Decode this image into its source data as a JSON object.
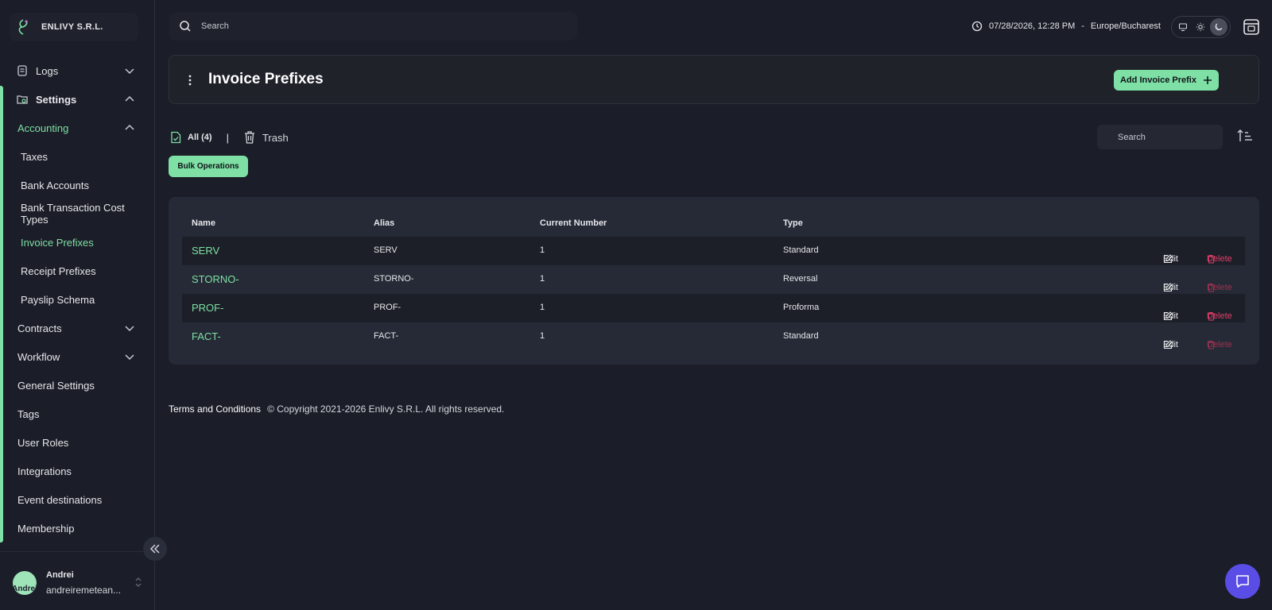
{
  "org": {
    "name": "ENLIVY S.R.L."
  },
  "sidebar": {
    "items": [
      {
        "label": "Logs"
      },
      {
        "label": "Settings"
      },
      {
        "label": "Accounting"
      },
      {
        "label": "Taxes"
      },
      {
        "label": "Bank Accounts"
      },
      {
        "label": "Bank Transaction Cost Types"
      },
      {
        "label": "Invoice Prefixes"
      },
      {
        "label": "Receipt Prefixes"
      },
      {
        "label": "Payslip Schema"
      },
      {
        "label": "Contracts"
      },
      {
        "label": "Workflow"
      },
      {
        "label": "General Settings"
      },
      {
        "label": "Tags"
      },
      {
        "label": "User Roles"
      },
      {
        "label": "Integrations"
      },
      {
        "label": "Event destinations"
      },
      {
        "label": "Membership"
      }
    ],
    "user": {
      "name": "Andrei",
      "email": "andreiremetean...",
      "avatar_text": "Andrei"
    }
  },
  "topbar": {
    "search_placeholder": "Search",
    "datetime": "07/28/2026, 12:28 PM",
    "dash": "-",
    "timezone": "Europe/Bucharest"
  },
  "header": {
    "title": "Invoice Prefixes",
    "add_label": "Add Invoice Prefix"
  },
  "filters": {
    "all_label": "All (4)",
    "separator": "|",
    "trash_label": "Trash",
    "search_placeholder": "Search",
    "bulk_label": "Bulk Operations"
  },
  "table": {
    "columns": [
      "Name",
      "Alias",
      "Current Number",
      "Type"
    ],
    "edit_label": "Edit",
    "delete_label": "Delete",
    "rows": [
      {
        "name": "SERV",
        "alias": "SERV",
        "current_number": "1",
        "type": "Standard"
      },
      {
        "name": "STORNO-",
        "alias": "STORNO-",
        "current_number": "1",
        "type": "Reversal"
      },
      {
        "name": "PROF-",
        "alias": "PROF-",
        "current_number": "1",
        "type": "Proforma"
      },
      {
        "name": "FACT-",
        "alias": "FACT-",
        "current_number": "1",
        "type": "Standard"
      }
    ]
  },
  "footer": {
    "terms": "Terms and Conditions",
    "copyright": "© Copyright 2021-2026 Enlivy S.R.L. All rights reserved."
  },
  "colors": {
    "accent": "#7ee0a4",
    "danger": "#e23d6a",
    "chat": "#5a4de6",
    "background": "#1b1d28"
  }
}
